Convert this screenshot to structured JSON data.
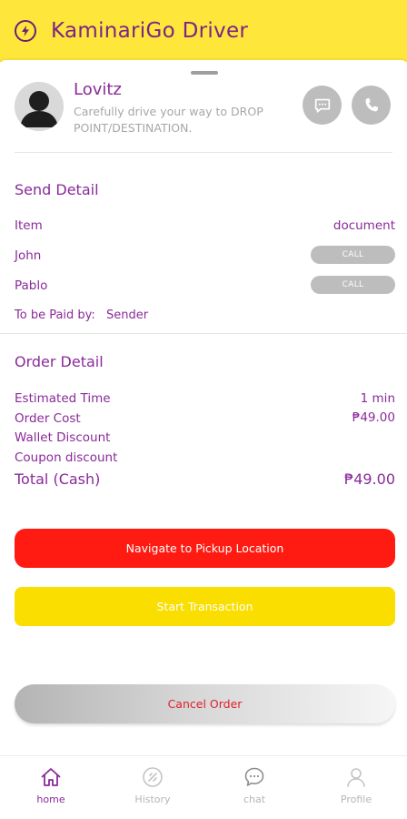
{
  "app": {
    "title": "KaminariGo Driver"
  },
  "driver": {
    "name": "Lovitz",
    "message": "Carefully drive your way to DROP POINT/DESTINATION."
  },
  "send_detail": {
    "title": "Send Detail",
    "item_label": "Item",
    "item_value": "document",
    "contacts": [
      {
        "name": "John",
        "call_label": "CALL"
      },
      {
        "name": "Pablo",
        "call_label": "CALL"
      }
    ],
    "paid_by_label": "To be Paid by:",
    "paid_by_value": "Sender"
  },
  "order_detail": {
    "title": "Order Detail",
    "rows": [
      {
        "label": "Estimated Time",
        "value": "1 min"
      },
      {
        "label": "Order Cost",
        "value": "₱49.00"
      },
      {
        "label": "Wallet Discount",
        "value": ""
      },
      {
        "label": "Coupon discount",
        "value": ""
      }
    ],
    "total_label": "Total (Cash)",
    "total_value": "₱49.00"
  },
  "actions": {
    "navigate_label": "Navigate to Pickup Location",
    "start_label": "Start Transaction",
    "cancel_label": "Cancel Order"
  },
  "nav": [
    {
      "label": "home",
      "icon": "home-icon",
      "active": true
    },
    {
      "label": "History",
      "icon": "history-icon",
      "active": false
    },
    {
      "label": "chat",
      "icon": "chat-icon",
      "active": false
    },
    {
      "label": "Profile",
      "icon": "profile-icon",
      "active": false
    }
  ],
  "colors": {
    "header": "#ffe63a",
    "accent_text": "#8a2a9a",
    "navigate_button": "#ff1a12",
    "start_button": "#f9de00",
    "cancel_text": "#e0202a"
  }
}
